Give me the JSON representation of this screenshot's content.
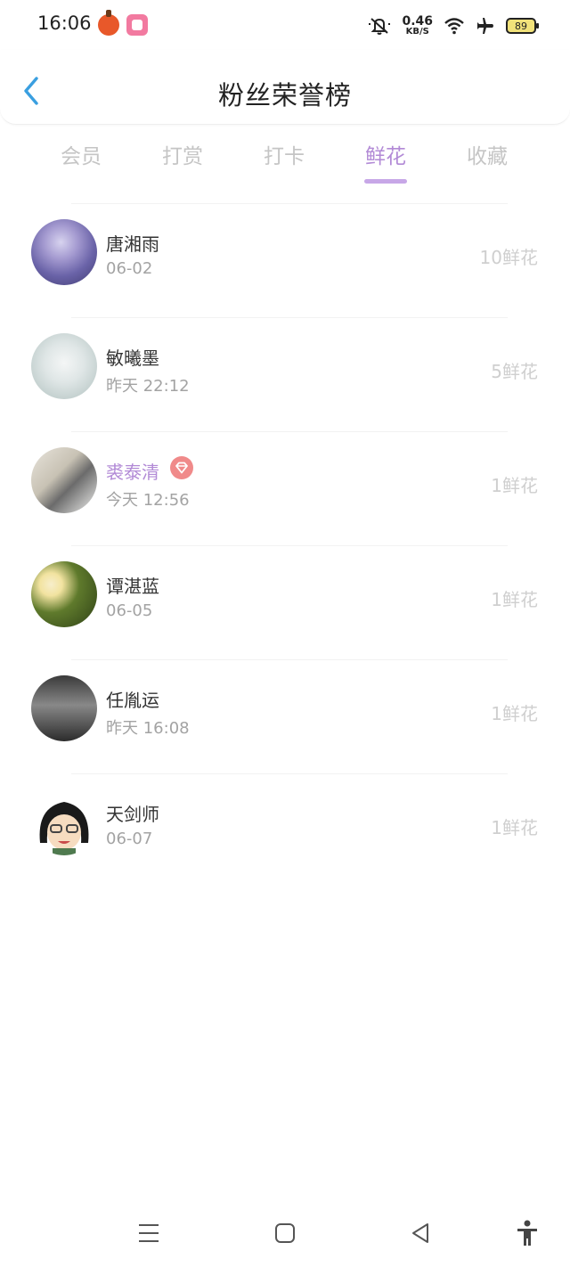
{
  "status": {
    "time": "16:06",
    "net_speed_value": "0.46",
    "net_speed_unit": "KB/S",
    "battery": "89"
  },
  "header": {
    "title": "粉丝荣誉榜"
  },
  "tabs": [
    {
      "label": "会员",
      "active": false
    },
    {
      "label": "打赏",
      "active": false
    },
    {
      "label": "打卡",
      "active": false
    },
    {
      "label": "鲜花",
      "active": true
    },
    {
      "label": "收藏",
      "active": false
    }
  ],
  "fans": [
    {
      "name": "唐湘雨",
      "time": "06-02",
      "count": "10鲜花",
      "vip": false
    },
    {
      "name": "敏曦墨",
      "time": "昨天 22:12",
      "count": "5鲜花",
      "vip": false
    },
    {
      "name": "裘泰清",
      "time": "今天 12:56",
      "count": "1鲜花",
      "vip": true
    },
    {
      "name": "谭湛蓝",
      "time": "06-05",
      "count": "1鲜花",
      "vip": false
    },
    {
      "name": "任胤运",
      "time": "昨天 16:08",
      "count": "1鲜花",
      "vip": false
    },
    {
      "name": "天剑师",
      "time": "06-07",
      "count": "1鲜花",
      "vip": false
    }
  ],
  "colors": {
    "accent": "#b28ad6",
    "back_arrow": "#3a9fe0",
    "vip_badge": "#f08a8a"
  }
}
